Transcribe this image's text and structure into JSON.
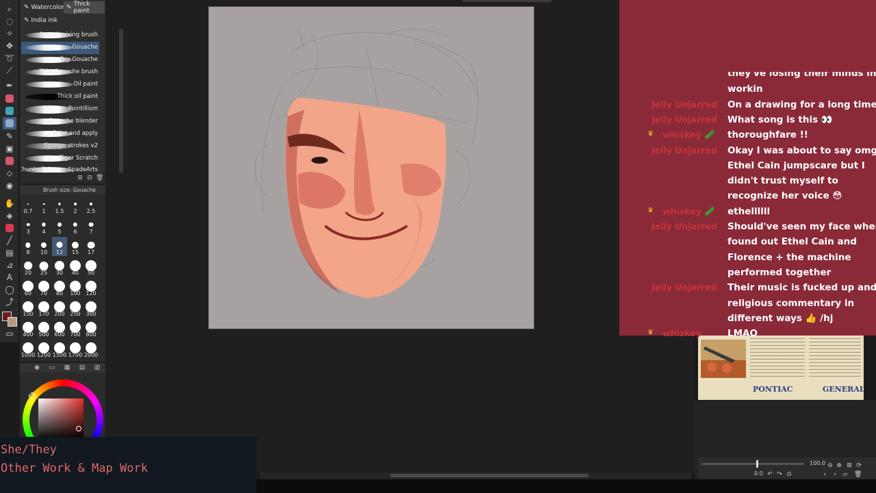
{
  "subtool": {
    "tabs": [
      {
        "label": "Watercolor",
        "active": false
      },
      {
        "label": "Thick paint",
        "active": true
      },
      {
        "label": "India ink",
        "active": false
      }
    ],
    "brushes": [
      {
        "label": "Round mixing brush",
        "selected": false
      },
      {
        "label": "Gouache",
        "selected": true
      },
      {
        "label": "Dry Gouache",
        "selected": false
      },
      {
        "label": "Thin Gouache brush",
        "selected": false
      },
      {
        "label": "Oil paint",
        "selected": false
      },
      {
        "label": "Thick oil paint",
        "selected": false
      },
      {
        "label": "Pointillism",
        "selected": false
      },
      {
        "label": "Gouache blender",
        "selected": false
      },
      {
        "label": "Paint and apply",
        "selected": false
      },
      {
        "label": "Sponge strokes v2",
        "selected": false
      },
      {
        "label": "Tiger Scratch",
        "selected": false
      },
      {
        "label": "Chunky Painter - SpadeArts",
        "selected": false
      }
    ]
  },
  "brush_size": {
    "title": "Brush size: Gouache",
    "sizes": [
      "0.7",
      "1",
      "1.5",
      "2",
      "2.5",
      "3",
      "4",
      "5",
      "6",
      "7",
      "8",
      "10",
      "12",
      "15",
      "17",
      "20",
      "25",
      "30",
      "40",
      "50",
      "60",
      "70",
      "80",
      "100",
      "120",
      "150",
      "170",
      "200",
      "250",
      "300",
      "400",
      "500",
      "600",
      "700",
      "800",
      "1000",
      "1200",
      "1500",
      "1700",
      "2000"
    ],
    "selected": "12"
  },
  "colors": {
    "main": "#6b1d1d",
    "sub": "#b99986",
    "chat_bg": "#8a2a38",
    "username": "#c9323c",
    "info_text": "#e06a6a"
  },
  "chat": {
    "messages": [
      {
        "user": "",
        "crown": false,
        "lines": [
          "they've losing their minds in their"
        ],
        "partial": true
      },
      {
        "user": "",
        "crown": false,
        "lines": [
          "workin"
        ]
      },
      {
        "user": "Jelly Unjarred",
        "crown": false,
        "lines": [
          "On a drawing for a long time"
        ]
      },
      {
        "user": "Jelly Unjarred",
        "crown": false,
        "lines": [
          "What song is this 👀"
        ]
      },
      {
        "user": "whiskey 🥒",
        "crown": true,
        "lines": [
          "thoroughfare !!"
        ]
      },
      {
        "user": "Jelly Unjarred",
        "crown": false,
        "lines": [
          "Okay I was about to say omg",
          "Ethel Cain jumpscare but I",
          "didn't trust myself to",
          "recognize her voice 😳"
        ]
      },
      {
        "user": "whiskey 🥒",
        "crown": true,
        "lines": [
          "ethellllll"
        ]
      },
      {
        "user": "Jelly Unjarred",
        "crown": false,
        "lines": [
          "Should've seen my face when I",
          "found out Ethel Cain and",
          "Florence + the machine",
          "performed together"
        ]
      },
      {
        "user": "Jelly Unjarred",
        "crown": false,
        "lines": [
          "Their music is fucked up and",
          "religious commentary in",
          "different ways 👍 /hj"
        ]
      },
      {
        "user": "whiskey",
        "crown": true,
        "lines": [
          "LMAO"
        ]
      }
    ]
  },
  "reference": {
    "brand_left": "PONTIAC",
    "brand_right": "GENERAL"
  },
  "navigator": {
    "zoom": "100.0",
    "rotation": "0.0"
  },
  "info": {
    "pronouns": "She/They",
    "work": "Other Work & Map Work"
  },
  "tools": [
    "zoom-icon",
    "select-icon",
    "wand-icon",
    "move-icon",
    "lasso-icon",
    "eyedropper-icon",
    "pen-icon",
    "brush-icon",
    "airbrush-icon",
    "decoration-icon",
    "pencil-icon",
    "blend-icon",
    "fill-icon",
    "eraser-icon",
    "gradient-icon",
    "hand-icon",
    "bucket-icon",
    "color-icon",
    "line-icon",
    "frame-icon",
    "ruler-icon",
    "text-icon",
    "balloon-icon",
    "correct-icon"
  ]
}
